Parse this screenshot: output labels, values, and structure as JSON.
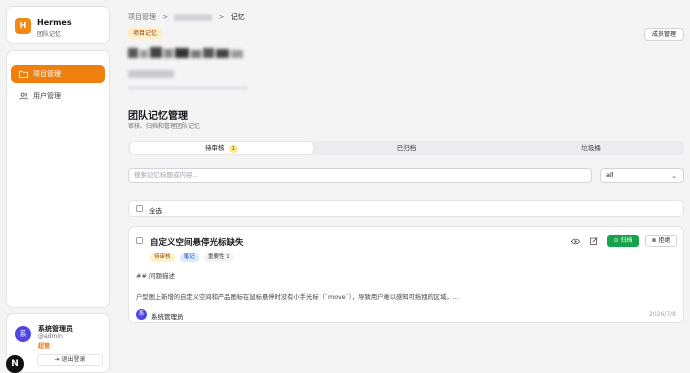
{
  "app": {
    "name": "Hermes",
    "subtitle": "团队记忆",
    "logo_letter": "H"
  },
  "sidebar": {
    "items": [
      {
        "label": "项目管理",
        "icon": "folder-icon",
        "active": true
      },
      {
        "label": "用户管理",
        "icon": "users-icon",
        "active": false
      }
    ]
  },
  "user": {
    "avatar_letter": "系",
    "name": "系统管理员",
    "handle": "@admin",
    "role": "超管",
    "logout_label": "退出登录"
  },
  "nextjs_badge": "N",
  "breadcrumb": {
    "root": "项目管理",
    "sep": ">",
    "current": "记忆"
  },
  "project": {
    "tag": "项目记忆"
  },
  "header": {
    "members_button": "成员管理"
  },
  "section": {
    "title": "团队记忆管理",
    "subtitle": "审核、归档和管理团队记忆"
  },
  "tabs": [
    {
      "label": "待审核",
      "count": "1",
      "active": true
    },
    {
      "label": "已归档",
      "active": false
    },
    {
      "label": "垃圾桶",
      "active": false
    }
  ],
  "search": {
    "placeholder": "搜索记忆标题或内容...",
    "value": ""
  },
  "filter": {
    "selected": "all"
  },
  "select_all_label": "全选",
  "memory": {
    "title": "自定义空间悬停光标缺失",
    "badges": {
      "status": "待审核",
      "type": "笔记",
      "importance": "重要性 1"
    },
    "body_heading": "## 问题描述",
    "body_text": "户型图上新增的自定义空间和产品图标在鼠标悬停时没有小手光标（`move`），导致用户难以感知可拖拽的区域。...",
    "archive_label": "归档",
    "reject_label": "拒绝",
    "author_letter": "系",
    "author": "系统管理员",
    "date": "2026/7/8"
  },
  "colors": {
    "accent": "#ef7f0f",
    "success": "#16a34a",
    "avatar": "#4f46e5"
  }
}
